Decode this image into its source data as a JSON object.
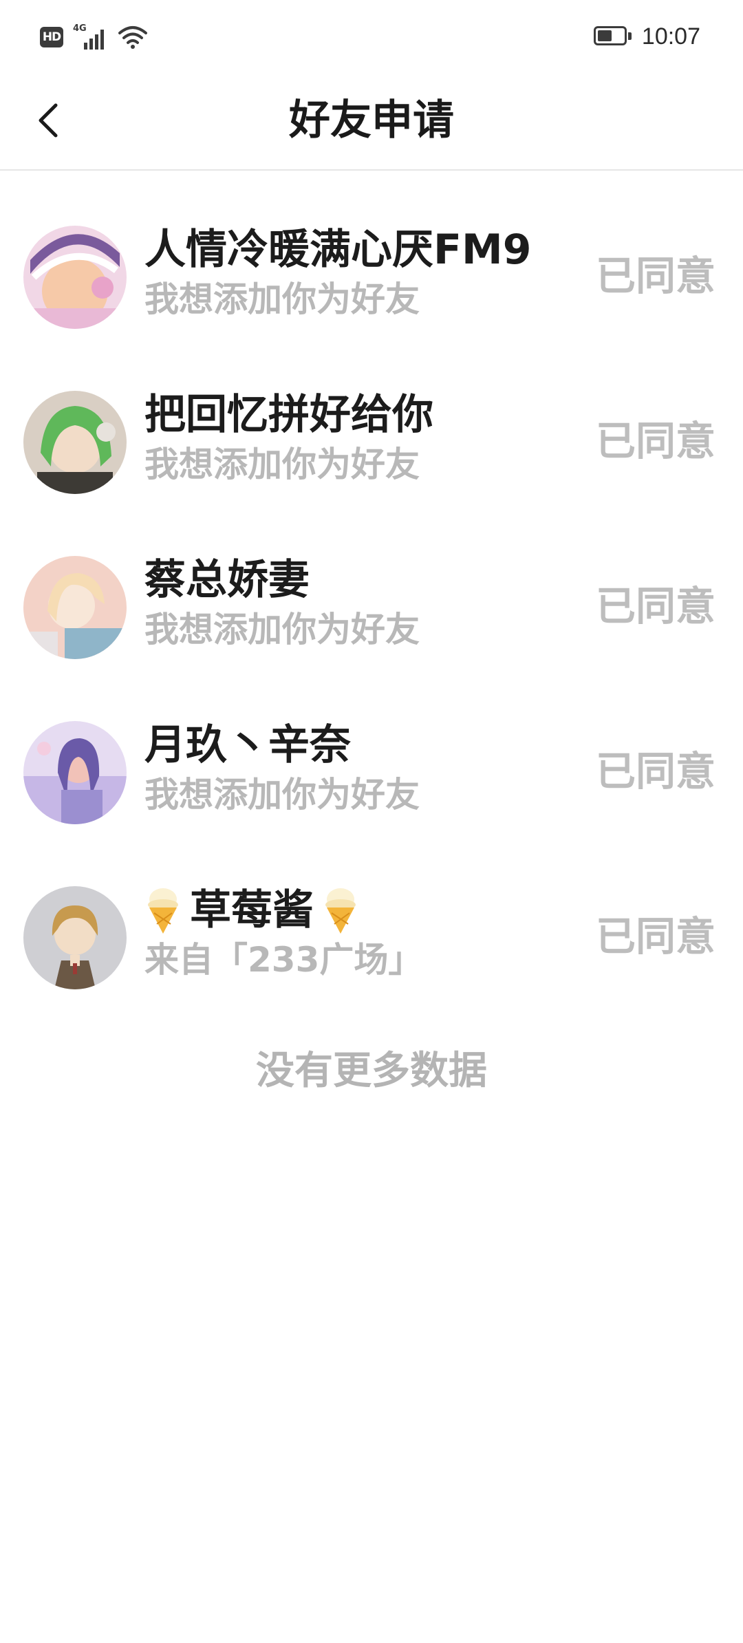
{
  "status_bar": {
    "hd_label": "HD",
    "network_label": "4G",
    "time": "10:07",
    "icons": [
      "hd-icon",
      "signal-icon",
      "wifi-icon",
      "battery-icon"
    ]
  },
  "header": {
    "title": "好友申请",
    "back_icon": "chevron-left-icon"
  },
  "requests": [
    {
      "nickname": "人情冷暖满心厌FM9",
      "subtitle": "我想添加你为好友",
      "status": "已同意",
      "avatar_colors": [
        "#e9b9d6",
        "#7a5a9c",
        "#f6c9a8"
      ]
    },
    {
      "nickname": "把回忆拼好给你",
      "subtitle": "我想添加你为好友",
      "status": "已同意",
      "avatar_colors": [
        "#5fb85a",
        "#3d3a35",
        "#f2dcc8"
      ]
    },
    {
      "nickname": "蔡总娇妻",
      "subtitle": "我想添加你为好友",
      "status": "已同意",
      "avatar_colors": [
        "#f3d2c7",
        "#8fb5c9",
        "#f8e7d8"
      ]
    },
    {
      "nickname": "月玖丶辛奈",
      "subtitle": "我想添加你为好友",
      "status": "已同意",
      "avatar_colors": [
        "#c6b7e6",
        "#6a5aa8",
        "#f1c2b8"
      ]
    },
    {
      "nickname": "草莓酱",
      "nickname_prefix_icon": "ice-cream-icon",
      "nickname_suffix_icon": "ice-cream-icon",
      "subtitle": "来自「233广场」",
      "status": "已同意",
      "avatar_colors": [
        "#cfcfd3",
        "#c79a4e",
        "#f2ddc6"
      ]
    }
  ],
  "footer": {
    "end_text": "没有更多数据"
  },
  "colors": {
    "title": "#1a1a1a",
    "nickname": "#1c1c1c",
    "subtitle": "#b8b8b8",
    "status": "#bdbdbd",
    "divider": "#e6e6e6",
    "background": "#ffffff"
  }
}
